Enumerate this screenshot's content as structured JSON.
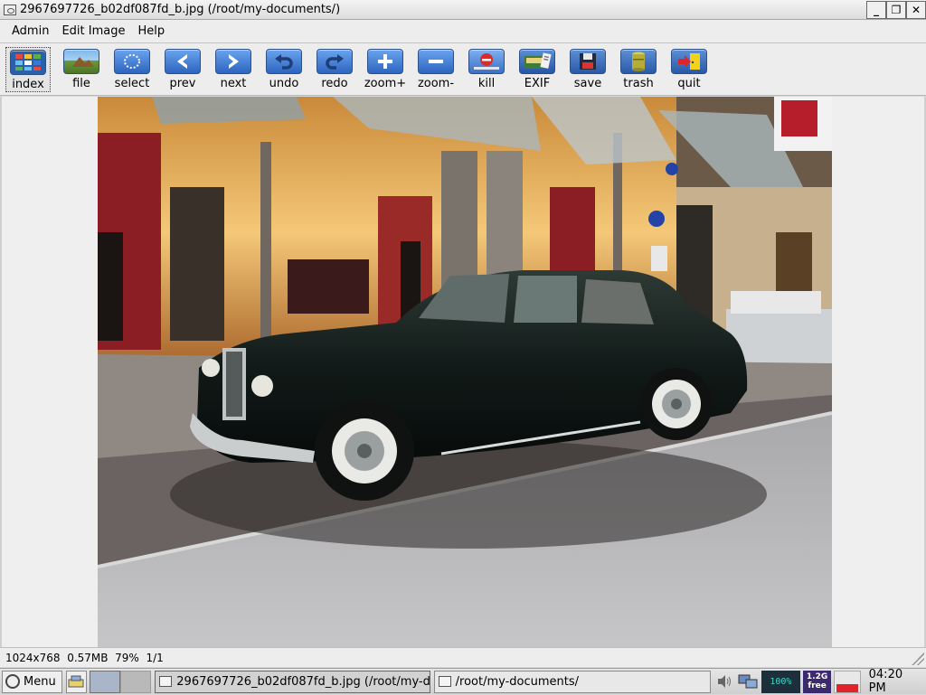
{
  "window": {
    "title": "2967697726_b02df087fd_b.jpg (/root/my-documents/)",
    "buttons": [
      "_",
      "❐",
      "✕"
    ]
  },
  "menubar": {
    "items": [
      "Admin",
      "Edit Image",
      "Help"
    ]
  },
  "toolbar": {
    "tools": [
      {
        "label": "index",
        "icon": "grid-index-icon",
        "active": true
      },
      {
        "label": "file",
        "icon": "image-file-icon"
      },
      {
        "label": "select",
        "icon": "select-dotted-circle-icon"
      },
      {
        "label": "prev",
        "icon": "arrow-left-icon"
      },
      {
        "label": "next",
        "icon": "arrow-right-icon"
      },
      {
        "label": "undo",
        "icon": "undo-icon"
      },
      {
        "label": "redo",
        "icon": "redo-icon"
      },
      {
        "label": "zoom+",
        "icon": "plus-icon"
      },
      {
        "label": "zoom-",
        "icon": "minus-icon"
      },
      {
        "label": "kill",
        "icon": "no-entry-icon"
      },
      {
        "label": "EXIF",
        "icon": "exif-icon"
      },
      {
        "label": "save",
        "icon": "floppy-disk-icon"
      },
      {
        "label": "trash",
        "icon": "trash-can-icon"
      },
      {
        "label": "quit",
        "icon": "exit-door-icon"
      }
    ]
  },
  "image": {
    "description_icon": "photo-vintage-car-street"
  },
  "status": {
    "dimensions": "1024x768",
    "size": "0.57MB",
    "zoom": "79%",
    "position": "1/1"
  },
  "taskbar": {
    "menu_label": "Menu",
    "tasks": [
      {
        "label": "2967697726_b02df087fd_b.jpg (/root/my-do",
        "focused": true
      },
      {
        "label": "/root/my-documents/",
        "focused": false
      }
    ],
    "battery": "100%",
    "memory_value": "1.2G",
    "memory_label": "free",
    "cpu_load": 0.35,
    "clock": "04:20 PM"
  },
  "colors": {
    "toolbar_icon": "#2d64bf",
    "kill_red": "#d62c2c",
    "cpu_red": "#e0242c"
  }
}
